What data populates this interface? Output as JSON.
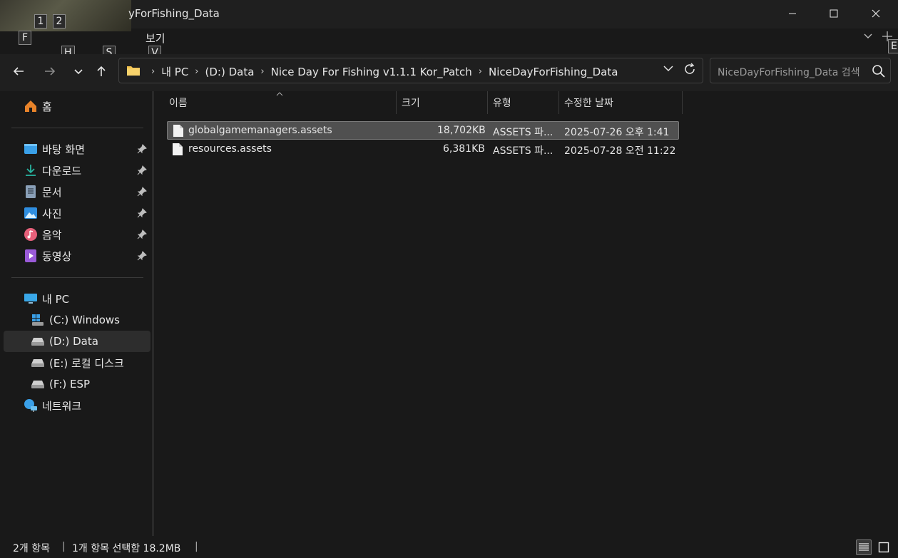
{
  "window": {
    "title": "NiceDayForFishing_Data",
    "title_visible": "yForFishing_Data",
    "minimize_icon": "minimize-icon",
    "maximize_icon": "maximize-icon",
    "close_icon": "close-icon"
  },
  "keytips": {
    "k1": "1",
    "k2": "2",
    "f": "F",
    "h": "H",
    "s": "S",
    "v": "V",
    "e": "E"
  },
  "ribbon": {
    "view_label": "보기"
  },
  "address": {
    "crumbs": [
      "내 PC",
      "(D:) Data",
      "Nice Day For Fishing v1.1.1 Kor_Patch",
      "NiceDayForFishing_Data"
    ]
  },
  "search": {
    "placeholder": "NiceDayForFishing_Data 검색"
  },
  "sidebar": {
    "home": "홈",
    "quick": [
      {
        "label": "바탕 화면",
        "icon": "desktop-icon"
      },
      {
        "label": "다운로드",
        "icon": "download-icon"
      },
      {
        "label": "문서",
        "icon": "document-icon"
      },
      {
        "label": "사진",
        "icon": "pictures-icon"
      },
      {
        "label": "음악",
        "icon": "music-icon"
      },
      {
        "label": "동영상",
        "icon": "video-icon"
      }
    ],
    "this_pc": "내 PC",
    "drives": [
      {
        "label": "(C:) Windows"
      },
      {
        "label": "(D:) Data",
        "selected": true
      },
      {
        "label": "(E:) 로컬 디스크"
      },
      {
        "label": "(F:) ESP"
      }
    ],
    "network": "네트워크"
  },
  "columns": {
    "name": "이름",
    "size": "크기",
    "type": "유형",
    "modified": "수정한 날짜"
  },
  "files": [
    {
      "name": "globalgamemanagers.assets",
      "size": "18,702KB",
      "type": "ASSETS 파...",
      "modified": "2025-07-26 오후 1:41",
      "selected": true
    },
    {
      "name": "resources.assets",
      "size": "6,381KB",
      "type": "ASSETS 파...",
      "modified": "2025-07-28 오전 11:22",
      "selected": false
    }
  ],
  "status": {
    "count": "2개 항목",
    "selection": "1개 항목 선택함 18.2MB"
  }
}
